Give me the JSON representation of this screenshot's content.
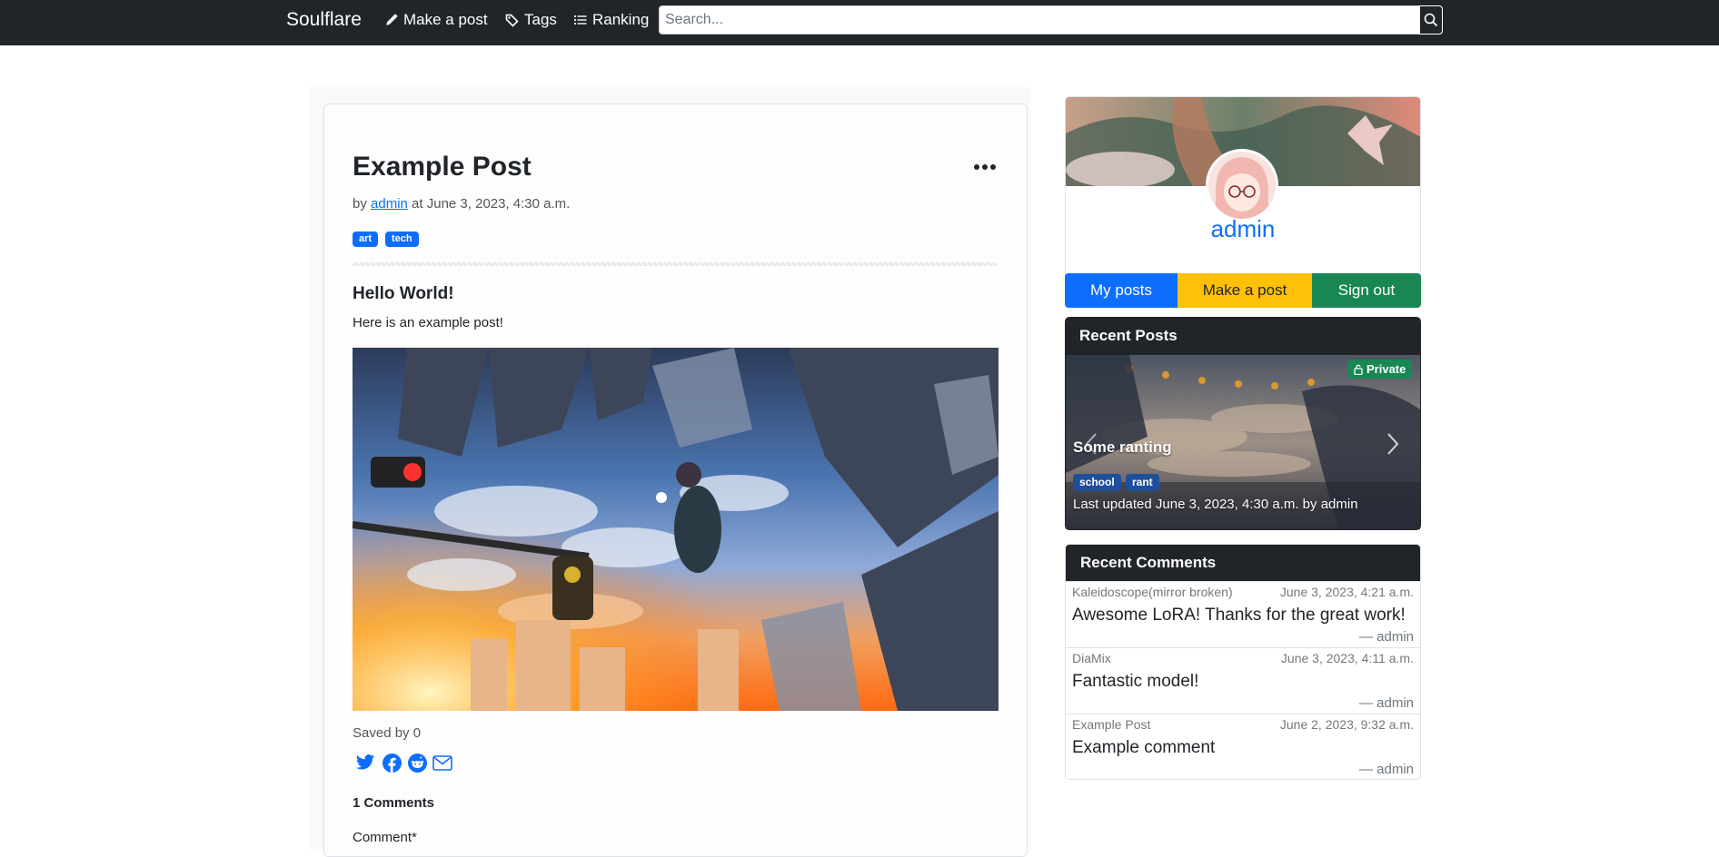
{
  "navbar": {
    "brand": "Soulflare",
    "links": [
      {
        "label": "Make a post",
        "icon": "pencil-icon"
      },
      {
        "label": "Tags",
        "icon": "tags-icon"
      },
      {
        "label": "Ranking",
        "icon": "list-icon"
      }
    ],
    "search_placeholder": "Search..."
  },
  "post": {
    "title": "Example Post",
    "by": "by",
    "author": "admin",
    "at": "at June 3, 2023, 4:30 a.m.",
    "tags": [
      "art",
      "tech"
    ],
    "heading": "Hello World!",
    "body": "Here is an example post!",
    "saved": "Saved by 0",
    "share_icons": [
      "twitter-icon",
      "facebook-icon",
      "reddit-icon",
      "email-icon"
    ],
    "comments_heading": "1 Comments",
    "comment_label": "Comment*"
  },
  "profile": {
    "name": "admin",
    "buttons": [
      {
        "label": "My posts",
        "color": "#0d6efd"
      },
      {
        "label": "Make a post",
        "color": "#ffc107"
      },
      {
        "label": "Sign out",
        "color": "#198754"
      }
    ]
  },
  "recent_posts": {
    "heading": "Recent Posts",
    "badge": "Private",
    "title": "Some ranting",
    "tags": [
      "school",
      "rant"
    ],
    "meta": "Last updated June 3, 2023, 4:30 a.m. by admin"
  },
  "recent_comments": {
    "heading": "Recent Comments",
    "items": [
      {
        "source": "Kaleidoscope(mirror broken)",
        "date": "June 3, 2023, 4:21 a.m.",
        "text": "Awesome LoRA! Thanks for the great work!",
        "author": "— admin"
      },
      {
        "source": "DiaMix",
        "date": "June 3, 2023, 4:11 a.m.",
        "text": "Fantastic model!",
        "author": "— admin"
      },
      {
        "source": "Example Post",
        "date": "June 2, 2023, 9:32 a.m.",
        "text": "Example comment",
        "author": "— admin"
      }
    ]
  }
}
